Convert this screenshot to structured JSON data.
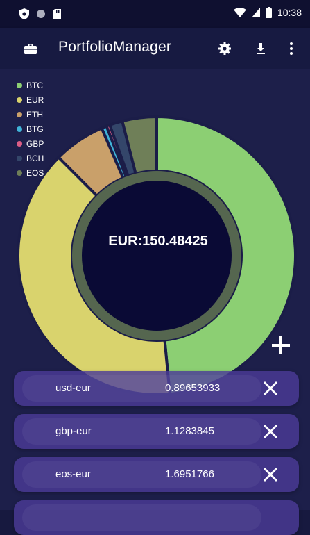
{
  "status_bar": {
    "time": "10:38",
    "icons": [
      "shield-icon",
      "circle-icon",
      "sd-card-icon",
      "wifi-icon",
      "signal-icon",
      "battery-icon"
    ]
  },
  "app_bar": {
    "title": "PortfolioManager",
    "left_icon": "briefcase-icon",
    "right_icons": [
      "settings-icon",
      "download-icon",
      "more-vert-icon"
    ]
  },
  "chart_data": {
    "type": "pie",
    "style": "donut",
    "center_label": "EUR:150.48425",
    "legend": [
      {
        "label": "BTC",
        "color": "#8ccf73"
      },
      {
        "label": "EUR",
        "color": "#d9d36d"
      },
      {
        "label": "ETH",
        "color": "#c9a06a"
      },
      {
        "label": "BTG",
        "color": "#40b3d8"
      },
      {
        "label": "GBP",
        "color": "#db5d86"
      },
      {
        "label": "BCH",
        "color": "#34466a"
      },
      {
        "label": "EOS",
        "color": "#6f7f58"
      }
    ],
    "slices": [
      {
        "label": "BTC",
        "value": 48.5
      },
      {
        "label": "EUR",
        "value": 39.0
      },
      {
        "label": "ETH",
        "value": 6.0
      },
      {
        "label": "BTG",
        "value": 0.6
      },
      {
        "label": "GBP",
        "value": 0.4
      },
      {
        "label": "BCH",
        "value": 1.5
      },
      {
        "label": "EOS",
        "value": 4.0
      }
    ],
    "legend_position": "top-left"
  },
  "actions": {
    "add_symbol": "+"
  },
  "rates": [
    {
      "name": "usd-eur",
      "value": "0.89653933"
    },
    {
      "name": "gbp-eur",
      "value": "1.1283845"
    },
    {
      "name": "eos-eur",
      "value": "1.6951766"
    }
  ]
}
